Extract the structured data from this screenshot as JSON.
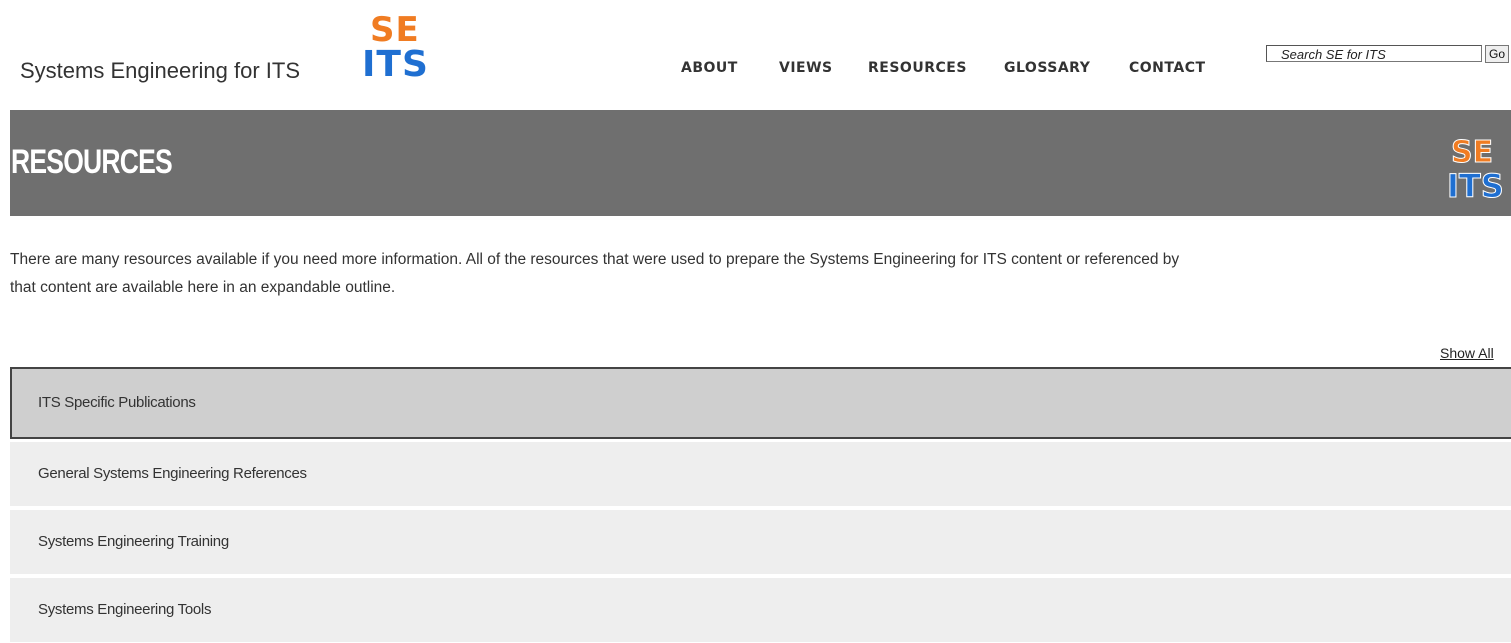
{
  "header": {
    "site_title": "Systems Engineering for ITS",
    "logo": {
      "top": "SE",
      "bottom": "ITS"
    },
    "nav": [
      {
        "label": "ABOUT"
      },
      {
        "label": "VIEWS"
      },
      {
        "label": "RESOURCES"
      },
      {
        "label": "GLOSSARY"
      },
      {
        "label": "CONTACT"
      }
    ],
    "search": {
      "placeholder": "Search SE for ITS",
      "button_label": "Go"
    }
  },
  "banner": {
    "title": "RESOURCES",
    "logo": {
      "top": "SE",
      "bottom": "ITS"
    }
  },
  "intro": {
    "line1": "There are many resources available if you need more information. All of the resources that were used to prepare the Systems Engineering for ITS content or referenced by",
    "line2": "that content are available here in an expandable outline."
  },
  "show_all_label": "Show All",
  "accordion": {
    "items": [
      {
        "label": "ITS Specific Publications",
        "active": true
      },
      {
        "label": "General Systems Engineering References",
        "active": false
      },
      {
        "label": "Systems Engineering Training",
        "active": false
      },
      {
        "label": "Systems Engineering Tools",
        "active": false
      }
    ]
  },
  "colors": {
    "logo_orange": "#f07c22",
    "logo_blue": "#1f6fd1",
    "banner_bg": "#6f6f6f",
    "item_bg": "#eeeeee",
    "active_item_bg": "#cfcfcf"
  }
}
